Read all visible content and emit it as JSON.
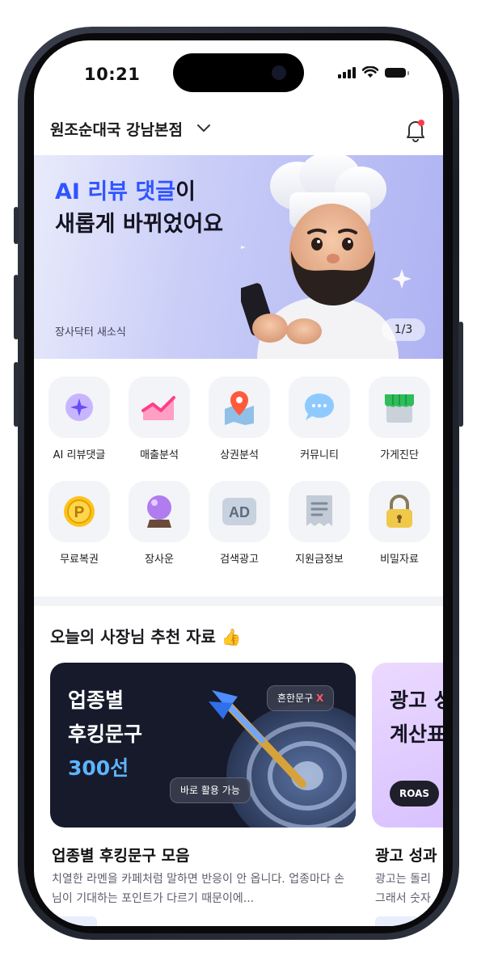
{
  "status_bar": {
    "time": "10:21"
  },
  "header": {
    "store_name": "원조순대국 강남본점"
  },
  "banner": {
    "title_line1_highlight": "AI 리뷰 댓글",
    "title_line1_rest": "이",
    "title_line2": "새롭게 바뀌었어요",
    "subtitle": "장사닥터 새소식",
    "pager": "1/3"
  },
  "menu": [
    [
      {
        "label": "AI 리뷰댓글",
        "icon": "ai-sparkle-icon"
      },
      {
        "label": "매출분석",
        "icon": "chart-icon"
      },
      {
        "label": "상권분석",
        "icon": "map-pin-icon"
      },
      {
        "label": "커뮤니티",
        "icon": "chat-bubble-icon"
      },
      {
        "label": "가게진단",
        "icon": "storefront-icon"
      }
    ],
    [
      {
        "label": "무료복권",
        "icon": "coin-p-icon"
      },
      {
        "label": "장사운",
        "icon": "crystal-ball-icon"
      },
      {
        "label": "검색광고",
        "icon": "ad-icon"
      },
      {
        "label": "지원금정보",
        "icon": "document-icon"
      },
      {
        "label": "비밀자료",
        "icon": "lock-icon"
      }
    ]
  ],
  "recommend": {
    "title": "오늘의 사장님 추천 자료 👍",
    "cards": [
      {
        "line1": "업종별",
        "line2": "후킹문구",
        "line3": "300선",
        "pill_top": "흔한문구",
        "pill_top_x": "X",
        "pill_bottom": "바로 활용 가능",
        "title": "업종별 후킹문구 모음",
        "desc": "치열한 라멘을 카페처럼 말하면 반응이 안 옵니다. 업종마다 손님이 기대하는 포인트가 다르기 때문이에..."
      },
      {
        "line1": "광고 성",
        "line2": "계산표",
        "badge": "ROAS",
        "title": "광고 성과",
        "desc_line1": "광고는 돌리",
        "desc_line2": "그래서 숫자"
      }
    ]
  },
  "colors": {
    "accent": "#2f55ff",
    "card_dark": "#161a2b",
    "card_purple": "#d7c1ff"
  }
}
